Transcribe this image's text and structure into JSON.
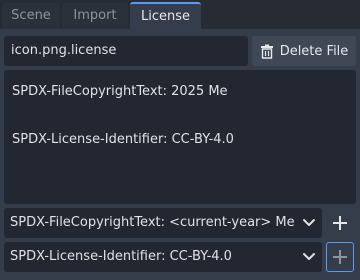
{
  "tabs": [
    {
      "label": "Scene"
    },
    {
      "label": "Import"
    },
    {
      "label": "License"
    }
  ],
  "active_tab": "License",
  "file": {
    "name": "icon.png.license"
  },
  "toolbar": {
    "delete_label": "Delete File"
  },
  "editor": {
    "lines": [
      "SPDX-FileCopyrightText: 2025 Me",
      "",
      "SPDX-License-Identifier: CC-BY-4.0"
    ]
  },
  "copyright_select": {
    "value": "SPDX-FileCopyrightText: <current-year> Me"
  },
  "license_select": {
    "value": "SPDX-License-Identifier: CC-BY-4.0"
  },
  "colors": {
    "accent": "#5b9cf6",
    "panel": "#363d4a",
    "field": "#222731",
    "tabbar": "#262b34"
  }
}
